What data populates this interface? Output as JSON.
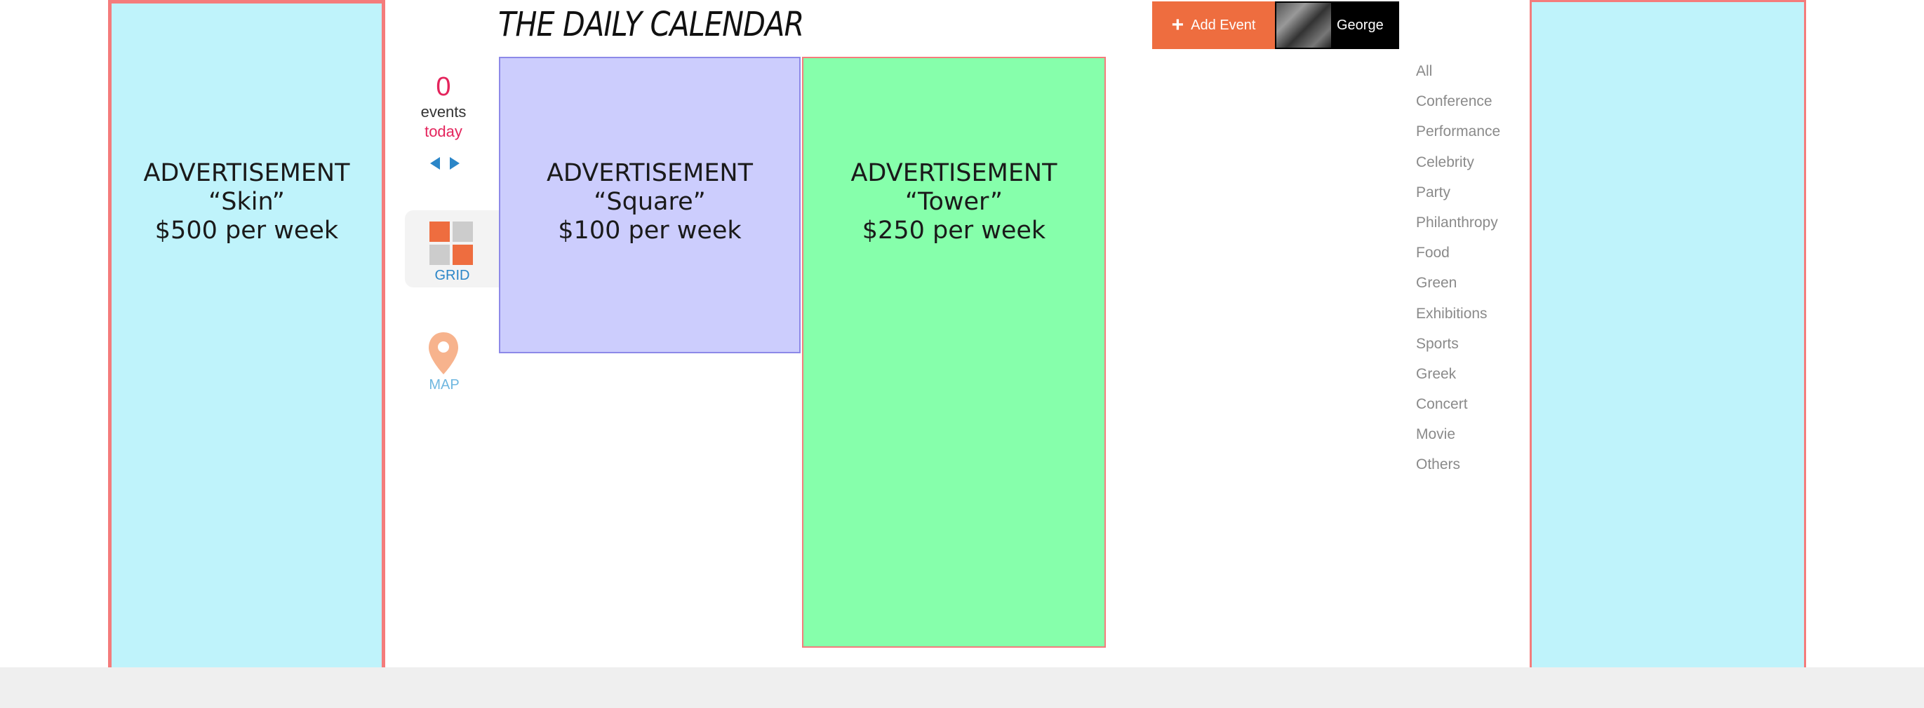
{
  "header": {
    "title": "THE DAILY CALENDAR",
    "add_event_label": "Add Event",
    "user_name": "George"
  },
  "ads": {
    "skin": {
      "line1": "ADVERTISEMENT",
      "line2": "“Skin”",
      "line3": "$500 per week"
    },
    "square": {
      "line1": "ADVERTISEMENT",
      "line2": "“Square”",
      "line3": "$100 per week"
    },
    "tower": {
      "line1": "ADVERTISEMENT",
      "line2": "“Tower”",
      "line3": "$250 per week"
    }
  },
  "counter": {
    "count": "0",
    "events_label": "events",
    "today_label": "today"
  },
  "views": {
    "grid_label": "GRID",
    "map_label": "MAP"
  },
  "categories": [
    "All",
    "Conference",
    "Performance",
    "Celebrity",
    "Party",
    "Philanthropy",
    "Food",
    "Green",
    "Exhibitions",
    "Sports",
    "Greek",
    "Concert",
    "Movie",
    "Others"
  ],
  "icons": {
    "add": "plus-icon",
    "prev": "arrow-left-icon",
    "next": "arrow-right-icon",
    "grid": "grid-icon",
    "map": "map-pin-icon"
  },
  "colors": {
    "accent": "#ee6d3f",
    "count_red": "#e4245c",
    "link_blue": "#2b86c8",
    "ad_skin": "#bff3fb",
    "ad_square": "#cccdfd",
    "ad_tower": "#86ffab",
    "ad_border": "#f47c7c",
    "grid_orange": "#ee6d3f",
    "grid_gray": "#cccccc",
    "map_pin": "#f7b38d"
  }
}
